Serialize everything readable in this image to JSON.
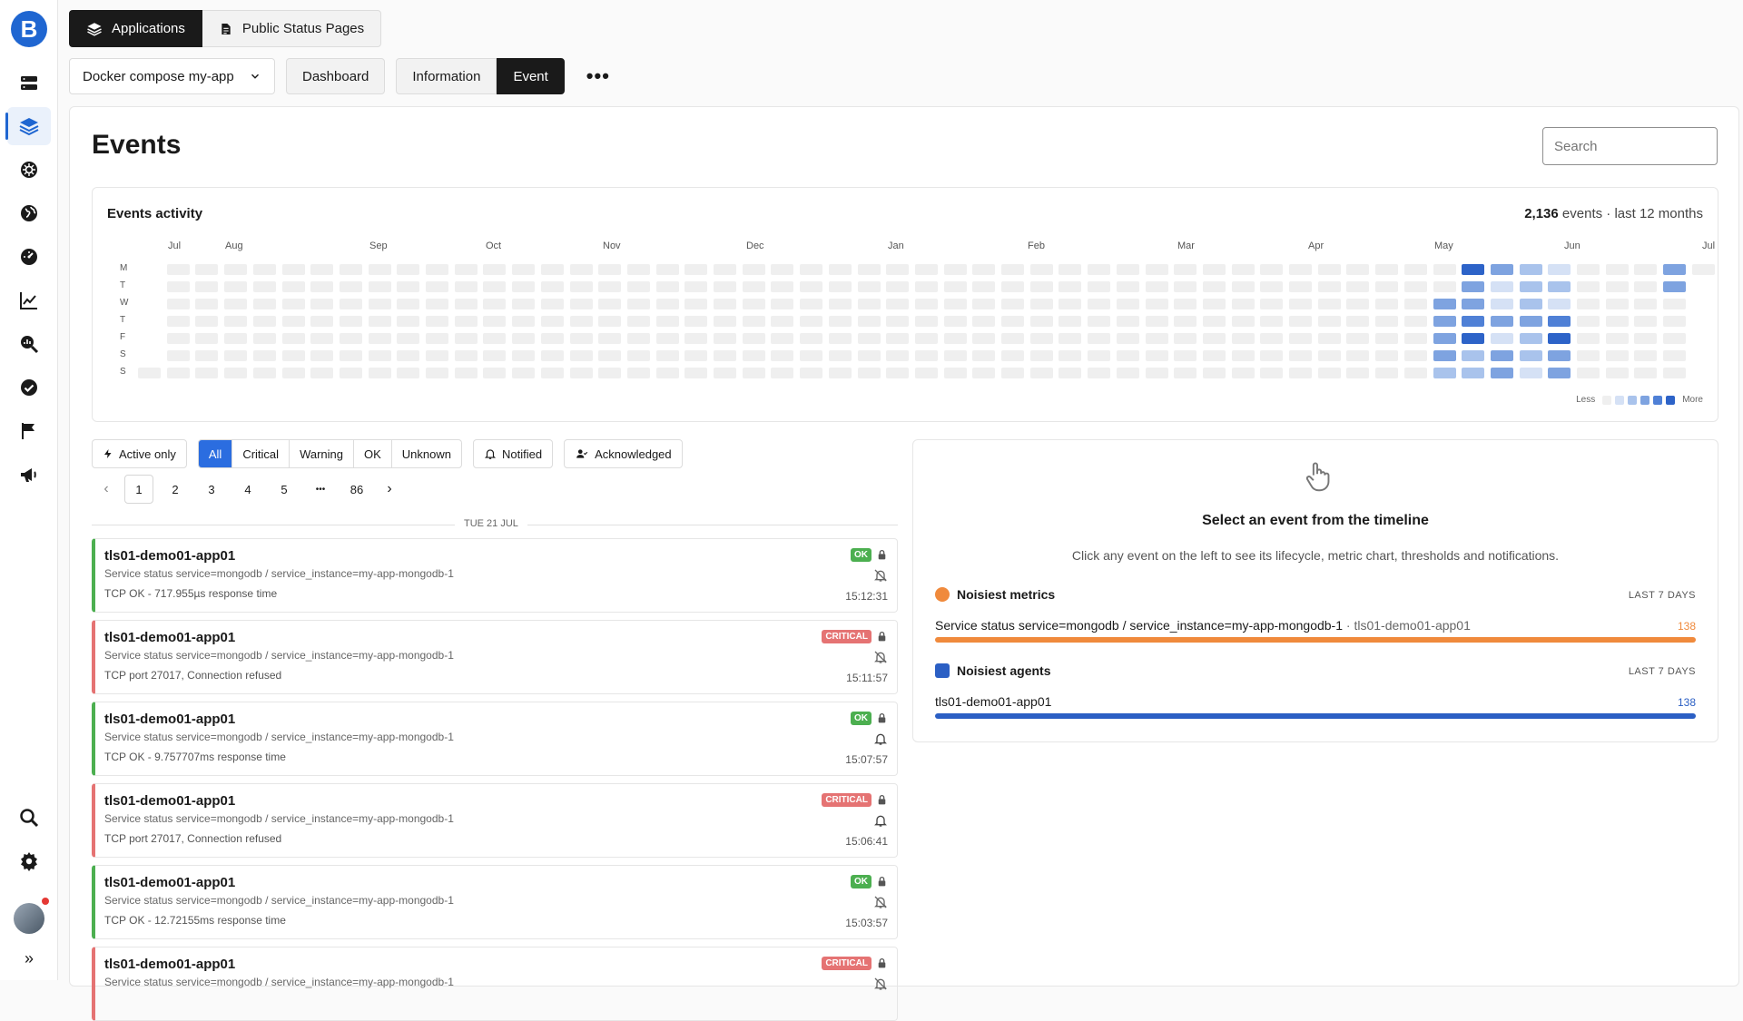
{
  "app": {
    "logo_letter": "B"
  },
  "sidebar": {
    "items": [
      {
        "name": "servers-icon"
      },
      {
        "name": "applications-icon"
      },
      {
        "name": "kubernetes-icon"
      },
      {
        "name": "globe-icon"
      },
      {
        "name": "dashboard-gauge-icon"
      },
      {
        "name": "metrics-chart-icon"
      },
      {
        "name": "analysis-icon"
      },
      {
        "name": "checks-icon"
      },
      {
        "name": "flag-icon"
      },
      {
        "name": "megaphone-icon"
      }
    ],
    "bottom_expand": "»"
  },
  "topbar": {
    "applications_label": "Applications",
    "status_pages_label": "Public Status Pages"
  },
  "subbar": {
    "app_select": "Docker compose my-app",
    "dashboard_label": "Dashboard",
    "information_label": "Information",
    "event_label": "Event",
    "more_label": "•••"
  },
  "page": {
    "title": "Events",
    "search_placeholder": "Search"
  },
  "activity": {
    "title": "Events activity",
    "count": "2,136",
    "count_suffix": " events · last 12 months",
    "months": [
      "Jul",
      "Aug",
      "Sep",
      "Oct",
      "Nov",
      "Dec",
      "Jan",
      "Feb",
      "Mar",
      "Apr",
      "May",
      "Jun",
      "Jul"
    ],
    "days": [
      "M",
      "T",
      "W",
      "T",
      "F",
      "S",
      "S"
    ],
    "legend_less": "Less",
    "legend_more": "More",
    "colors": [
      "#efefef",
      "#d5e1f5",
      "#a9c3ec",
      "#7ea3e0",
      "#4f80d6",
      "#2d63c8"
    ]
  },
  "filters": {
    "active_only": "Active only",
    "status": [
      "All",
      "Critical",
      "Warning",
      "OK",
      "Unknown"
    ],
    "notified": "Notified",
    "acknowledged": "Acknowledged"
  },
  "pager": {
    "prev": "‹",
    "pages": [
      "1",
      "2",
      "3",
      "4",
      "5",
      "•••",
      "86"
    ],
    "next": "›"
  },
  "date_separator": "TUE 21 JUL",
  "events": [
    {
      "host": "tls01-demo01-app01",
      "service": "Service status service=mongodb / service_instance=my-app-mongodb-1",
      "message": "TCP OK - 717.955µs response time",
      "status": "OK",
      "time": "15:12:31",
      "notified": false
    },
    {
      "host": "tls01-demo01-app01",
      "service": "Service status service=mongodb / service_instance=my-app-mongodb-1",
      "message": "TCP port 27017, Connection refused",
      "status": "CRITICAL",
      "time": "15:11:57",
      "notified": false
    },
    {
      "host": "tls01-demo01-app01",
      "service": "Service status service=mongodb / service_instance=my-app-mongodb-1",
      "message": "TCP OK - 9.757707ms response time",
      "status": "OK",
      "time": "15:07:57",
      "notified": true
    },
    {
      "host": "tls01-demo01-app01",
      "service": "Service status service=mongodb / service_instance=my-app-mongodb-1",
      "message": "TCP port 27017, Connection refused",
      "status": "CRITICAL",
      "time": "15:06:41",
      "notified": true
    },
    {
      "host": "tls01-demo01-app01",
      "service": "Service status service=mongodb / service_instance=my-app-mongodb-1",
      "message": "TCP OK - 12.72155ms response time",
      "status": "OK",
      "time": "15:03:57",
      "notified": false
    },
    {
      "host": "tls01-demo01-app01",
      "service": "Service status service=mongodb / service_instance=my-app-mongodb-1",
      "message": "",
      "status": "CRITICAL",
      "time": "",
      "notified": false
    }
  ],
  "detail": {
    "title": "Select an event from the timeline",
    "subtitle": "Click any event on the left to see its lifecycle, metric chart, thresholds and notifications.",
    "noisiest_metrics": {
      "title": "Noisiest metrics",
      "period": "LAST 7 DAYS",
      "label": "Service status service=mongodb / service_instance=my-app-mongodb-1",
      "agent": " · tls01-demo01-app01",
      "value": "138",
      "color": "#f08a3c"
    },
    "noisiest_agents": {
      "title": "Noisiest agents",
      "period": "LAST 7 DAYS",
      "label": "tls01-demo01-app01",
      "value": "138",
      "color": "#2b5fc4"
    }
  }
}
